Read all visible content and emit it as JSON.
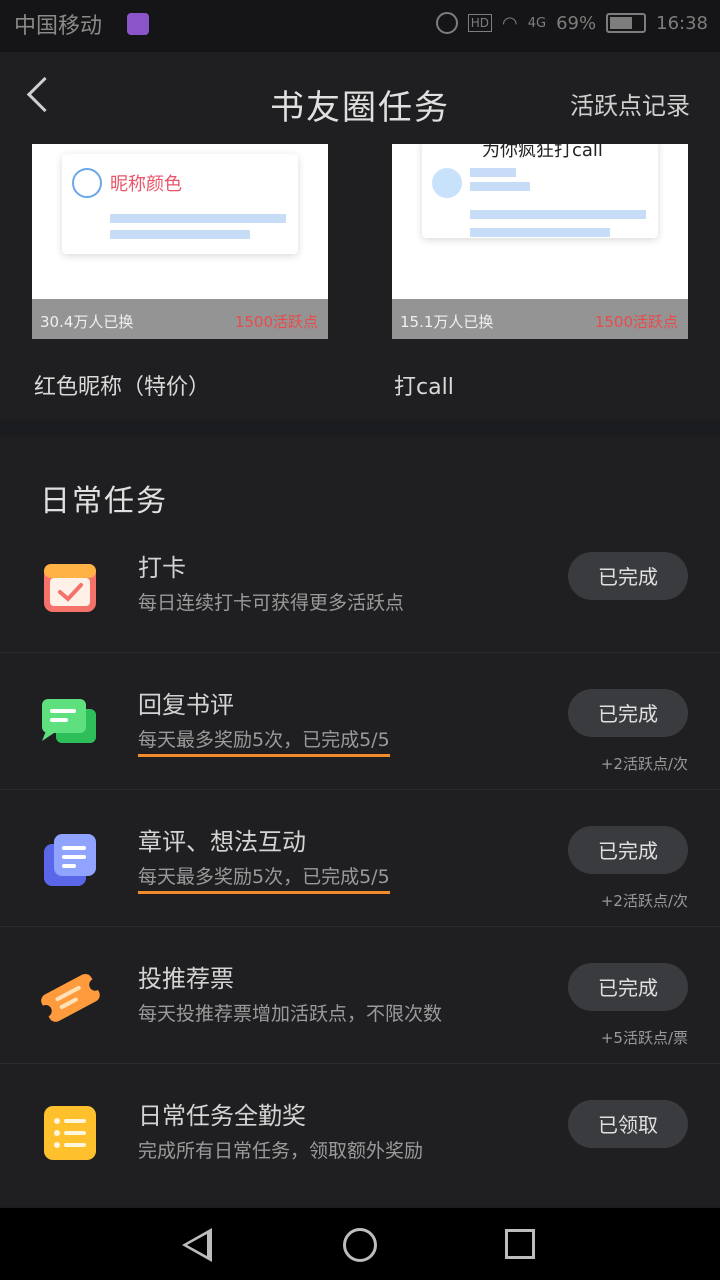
{
  "status_bar": {
    "carrier": "中国移动",
    "network": "4G",
    "hd": "HD",
    "battery": "69%",
    "time": "16:38"
  },
  "header": {
    "title": "书友圈任务",
    "link": "活跃点记录"
  },
  "rewards": [
    {
      "preview_label": "昵称颜色",
      "people": "30.4万人已换",
      "points": "1500活跃点",
      "name": "红色昵称（特价）"
    },
    {
      "preview_label": "为你疯狂打call",
      "people": "15.1万人已换",
      "points": "1500活跃点",
      "name": "打call"
    }
  ],
  "daily": {
    "title": "日常任务",
    "tasks": [
      {
        "name": "打卡",
        "desc": "每日连续打卡可获得更多活跃点",
        "button": "已完成",
        "note": ""
      },
      {
        "name": "回复书评",
        "desc": "每天最多奖励5次，已完成5/5",
        "button": "已完成",
        "note": "+2活跃点/次"
      },
      {
        "name": "章评、想法互动",
        "desc": "每天最多奖励5次，已完成5/5",
        "button": "已完成",
        "note": "+2活跃点/次"
      },
      {
        "name": "投推荐票",
        "desc": "每天投推荐票增加活跃点，不限次数",
        "button": "已完成",
        "note": "+5活跃点/票"
      },
      {
        "name": "日常任务全勤奖",
        "desc": "完成所有日常任务，领取额外奖励",
        "button": "已领取",
        "note": ""
      }
    ]
  },
  "icons": {
    "checkin": "calendar-check-icon",
    "reply": "chat-bubble-icon",
    "interact": "note-card-icon",
    "vote": "ticket-icon",
    "bonus": "checklist-icon"
  },
  "colors": {
    "accent_orange": "#f18a2b",
    "points_red": "#e94b4b"
  }
}
